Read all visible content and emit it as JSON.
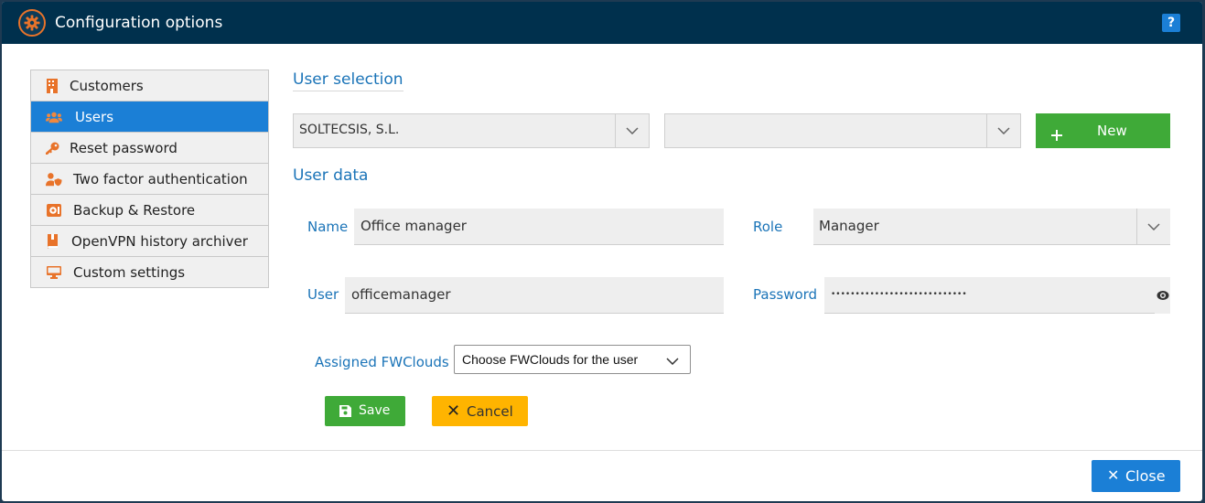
{
  "window": {
    "title": "Configuration options",
    "help_label": "?"
  },
  "sidebar": {
    "items": [
      {
        "label": "Customers",
        "icon": "building-icon"
      },
      {
        "label": "Users",
        "icon": "users-icon",
        "active": true
      },
      {
        "label": "Reset password",
        "icon": "key-icon"
      },
      {
        "label": "Two factor authentication",
        "icon": "user-shield-icon"
      },
      {
        "label": "Backup & Restore",
        "icon": "backup-icon"
      },
      {
        "label": "OpenVPN history archiver",
        "icon": "archive-book-icon"
      },
      {
        "label": "Custom settings",
        "icon": "desktop-icon"
      }
    ]
  },
  "user_selection": {
    "title": "User selection",
    "customer_value": "SOLTECSIS, S.L.",
    "user_value": "",
    "new_label": "New"
  },
  "user_data": {
    "title": "User data",
    "name_label": "Name",
    "name_value": "Office manager",
    "role_label": "Role",
    "role_value": "Manager",
    "user_label": "User",
    "user_value": "officemanager",
    "password_label": "Password",
    "password_value": "••••••••••••••••••••••••••••",
    "fwclouds_label": "Assigned FWClouds",
    "fwclouds_value": "Choose FWClouds for the user"
  },
  "actions": {
    "save_label": "Save",
    "cancel_label": "Cancel"
  },
  "footer": {
    "close_label": "Close"
  },
  "colors": {
    "titlebar": "#00304d",
    "accent": "#1b7fd6",
    "success": "#3faa38",
    "warning": "#ffb400",
    "icon_orange": "#e8732a"
  }
}
